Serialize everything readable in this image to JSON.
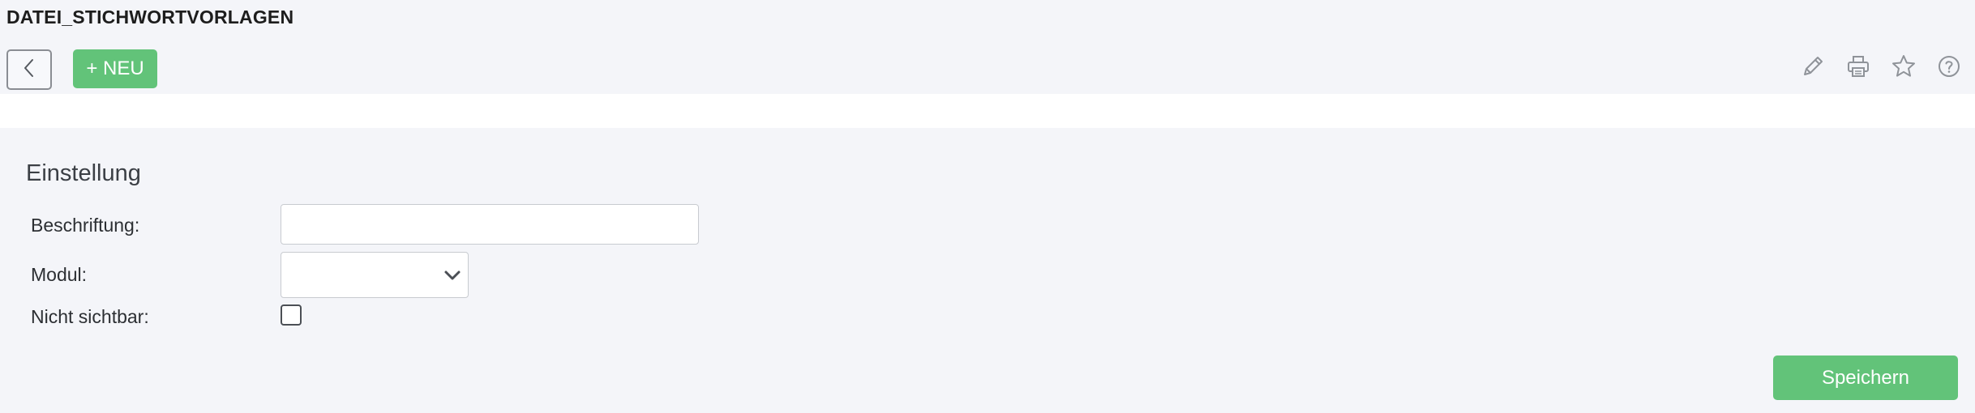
{
  "header": {
    "title": "DATEI_STICHWORTVORLAGEN"
  },
  "toolbar": {
    "back_icon": "chevron-left-icon",
    "new_label": "+ NEU",
    "actions": [
      "pencil-icon",
      "printer-icon",
      "star-icon",
      "help-circle-icon"
    ]
  },
  "form": {
    "section_title": "Einstellung",
    "fields": {
      "beschriftung": {
        "label": "Beschriftung:",
        "value": "",
        "placeholder": ""
      },
      "modul": {
        "label": "Modul:",
        "selected": ""
      },
      "nicht_sichtbar": {
        "label": "Nicht sichtbar:",
        "checked": false
      }
    },
    "save_label": "Speichern"
  },
  "colors": {
    "accent_green": "#62c379",
    "background": "#f4f5f9",
    "band": "#ffffff"
  }
}
